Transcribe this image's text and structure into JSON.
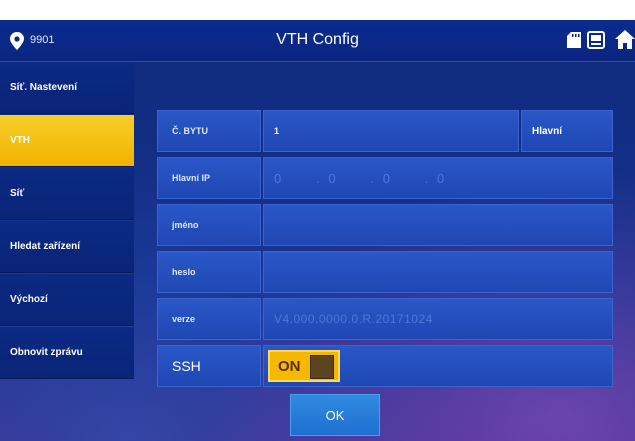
{
  "header": {
    "room_number": "9901",
    "title": "VTH Config",
    "icons": [
      "location-pin-icon",
      "sd-card-icon",
      "monitor-icon",
      "home-icon"
    ]
  },
  "sidebar": {
    "items": [
      {
        "label": "Síť. Nastevení",
        "active": false
      },
      {
        "label": "VTH",
        "active": true
      },
      {
        "label": "Síť",
        "active": false
      },
      {
        "label": "Hledat zařízení",
        "active": false
      },
      {
        "label": "Výchozí",
        "active": false
      },
      {
        "label": "Obnovit zprávu",
        "active": false
      }
    ]
  },
  "form": {
    "room_no_label": "Č. BYTU",
    "room_no_value": "1",
    "main_button": "Hlavní",
    "main_ip_label": "Hlavní IP",
    "main_ip_parts": [
      "0",
      "0",
      "0",
      "0"
    ],
    "name_label": "jméno",
    "name_value": "",
    "password_label": "heslo",
    "password_value": "",
    "version_label": "verze",
    "version_value": "V4.000.0000.0.R.20171024",
    "ssh_label": "SSH",
    "ssh_toggle": "ON"
  },
  "actions": {
    "ok_label": "OK"
  },
  "colors": {
    "accent_active": "#f3b200",
    "panel": "#1f47b4",
    "background": "#132f86",
    "ok_button": "#1f6fd0"
  }
}
